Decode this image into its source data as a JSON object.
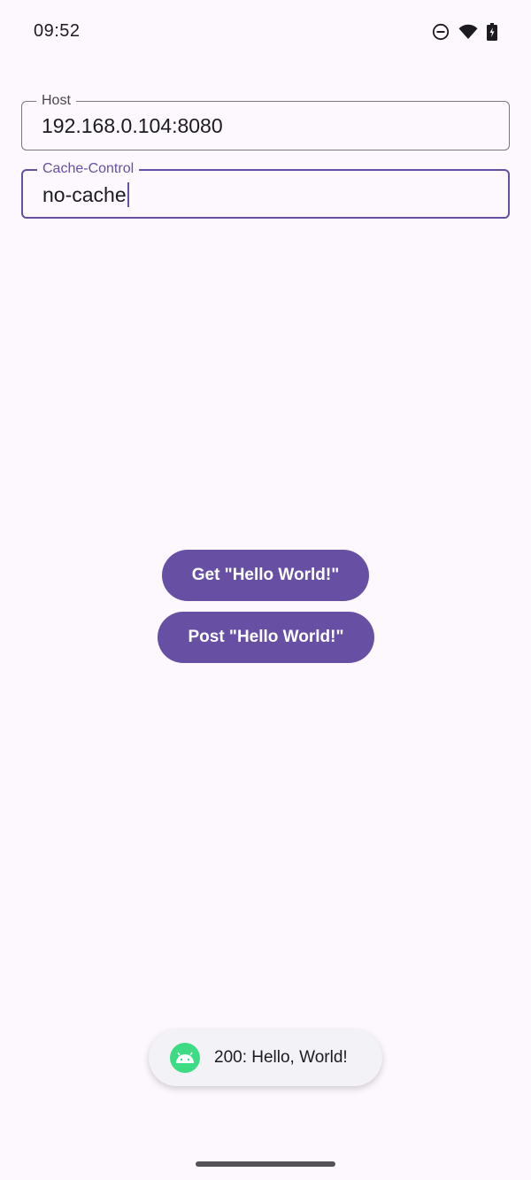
{
  "status_bar": {
    "time": "09:52",
    "icons": [
      "do-not-disturb-icon",
      "wifi-icon",
      "battery-charging-icon"
    ]
  },
  "fields": {
    "host": {
      "label": "Host",
      "value": "192.168.0.104:8080"
    },
    "cache_control": {
      "label": "Cache-Control",
      "value": "no-cache",
      "focused": true
    }
  },
  "buttons": {
    "get": "Get \"Hello World!\"",
    "post": "Post \"Hello World!\""
  },
  "toast": {
    "icon": "android-icon",
    "text": "200: Hello, World!"
  },
  "colors": {
    "accent": "#6750a4",
    "background": "#fdf8fd",
    "android_green": "#3ddc84"
  }
}
